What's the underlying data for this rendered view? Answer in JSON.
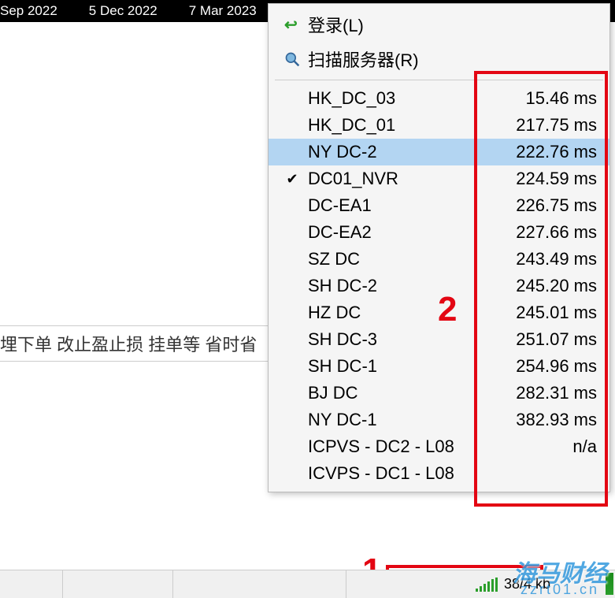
{
  "chart_header": {
    "date1": "Sep 2022",
    "date2": "5 Dec 2022",
    "date3": "7 Mar 2023"
  },
  "left_info_text": "埋下单 改止盈止损 挂单等 省时省",
  "menu": {
    "login_label": "登录(L)",
    "scan_label": "扫描服务器(R)"
  },
  "servers": [
    {
      "name": "HK_DC_03",
      "latency": "15.46 ms",
      "checked": false,
      "selected": false
    },
    {
      "name": "HK_DC_01",
      "latency": "217.75 ms",
      "checked": false,
      "selected": false
    },
    {
      "name": "NY DC-2",
      "latency": "222.76 ms",
      "checked": false,
      "selected": true
    },
    {
      "name": "DC01_NVR",
      "latency": "224.59 ms",
      "checked": true,
      "selected": false
    },
    {
      "name": "DC-EA1",
      "latency": "226.75 ms",
      "checked": false,
      "selected": false
    },
    {
      "name": "DC-EA2",
      "latency": "227.66 ms",
      "checked": false,
      "selected": false
    },
    {
      "name": "SZ DC",
      "latency": "243.49 ms",
      "checked": false,
      "selected": false
    },
    {
      "name": "SH DC-2",
      "latency": "245.20 ms",
      "checked": false,
      "selected": false
    },
    {
      "name": "HZ DC",
      "latency": "245.01 ms",
      "checked": false,
      "selected": false
    },
    {
      "name": "SH DC-3",
      "latency": "251.07 ms",
      "checked": false,
      "selected": false
    },
    {
      "name": "SH DC-1",
      "latency": "254.96 ms",
      "checked": false,
      "selected": false
    },
    {
      "name": "BJ DC",
      "latency": "282.31 ms",
      "checked": false,
      "selected": false
    },
    {
      "name": "NY DC-1",
      "latency": "382.93 ms",
      "checked": false,
      "selected": false
    },
    {
      "name": "ICPVS - DC2 - L08",
      "latency": "n/a",
      "checked": false,
      "selected": false
    },
    {
      "name": "ICVPS - DC1 - L08",
      "latency": "",
      "checked": false,
      "selected": false
    }
  ],
  "annotations": {
    "num1": "1",
    "num2": "2"
  },
  "status": {
    "traffic": "38/4 kb"
  },
  "watermark": {
    "brand": "海马财经",
    "url": "zzrt01.cn"
  }
}
